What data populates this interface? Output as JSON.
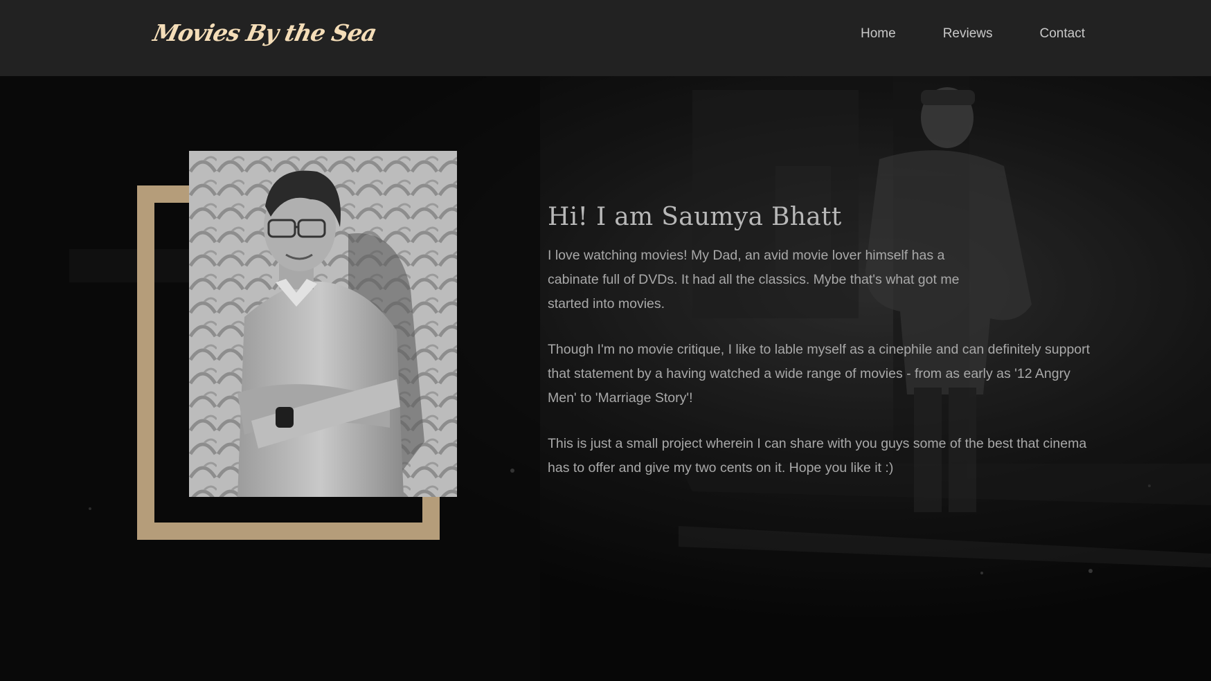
{
  "site": {
    "brand": "Movies By the Sea"
  },
  "nav": {
    "items": [
      {
        "label": "Home"
      },
      {
        "label": "Reviews"
      },
      {
        "label": "Contact"
      }
    ]
  },
  "about": {
    "heading": "Hi! I am Saumya Bhatt",
    "paragraphs": [
      "I love watching movies! My Dad, an avid movie lover himself has a cabinate full of DVDs. It had all the classics. Mybe that's what got me started into movies.",
      "Though I'm no movie critique, I like to lable myself as a cinephile and can definitely support that statement by a having watched a wide range of movies - from as early as '12 Angry Men' to 'Marriage Story'!",
      "This is just a small project wherein I can share with you guys some of the best that cinema has to offer and give my two cents on it. Hope you like it :)"
    ]
  },
  "colors": {
    "navbar_bg": "#222222",
    "brand": "#f4ddb8",
    "frame_accent": "#b59d7a",
    "page_bg": "#0b0b0b"
  }
}
